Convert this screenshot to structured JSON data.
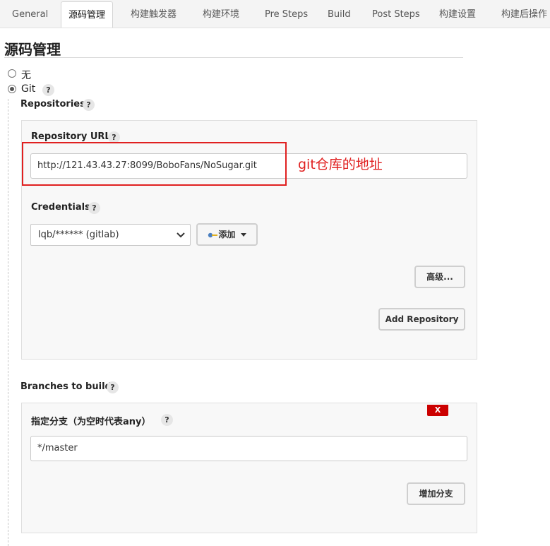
{
  "tabs": [
    {
      "label": "General",
      "active": false
    },
    {
      "label": "源码管理",
      "active": true
    },
    {
      "label": "构建触发器",
      "active": false
    },
    {
      "label": "构建环境",
      "active": false
    },
    {
      "label": "Pre Steps",
      "active": false
    },
    {
      "label": "Build",
      "active": false
    },
    {
      "label": "Post Steps",
      "active": false
    },
    {
      "label": "构建设置",
      "active": false
    },
    {
      "label": "构建后操作",
      "active": false
    }
  ],
  "section_title": "源码管理",
  "scm_options": [
    {
      "label": "无",
      "checked": false
    },
    {
      "label": "Git",
      "checked": true
    }
  ],
  "help_icon": "?",
  "repositories": {
    "label": "Repositories",
    "url_label": "Repository URL",
    "url_value": "http://121.43.43.27:8099/BoboFans/NoSugar.git",
    "credentials_label": "Credentials",
    "credentials_value": "lqb/****** (gitlab)",
    "add_button": "添加",
    "advanced_button": "高级...",
    "add_repository_button": "Add Repository"
  },
  "annotation": "git仓库的地址",
  "branches": {
    "label": "Branches to build",
    "delete_button": "X",
    "branch_label": "指定分支（为空时代表any）",
    "branch_value": "*/master",
    "add_branch_button": "增加分支"
  },
  "colors": {
    "annotation": "#e02020",
    "delete": "#cc0000"
  }
}
